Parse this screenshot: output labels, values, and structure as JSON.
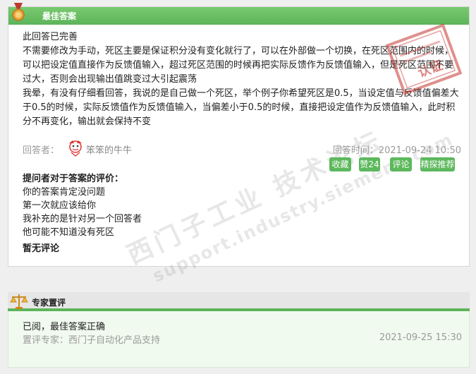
{
  "answer": {
    "header_title": "最佳答案",
    "body_lines": [
      "此回答已完善",
      "不需要修改为手动，死区主要是保证积分没有变化就行了，可以在外部做一个切换，在死区范围内的时候，可以把设定值直接作为反馈值输入，超过死区范围的时候再把实际反馈作为反馈值输入，但是死区范围不要过大，否则会出现输出值跳变过大引起震荡",
      "我晕，有没有仔细看回答，我说的是自己做一个死区，举个例子你希望死区是0.5，当设定值与反馈值偏差大于0.5的时候，实际反馈值作为反馈值输入，当偏差小于0.5的时候，直接把设定值作为反馈值输入，此时积分不再变化，输出就会保持不变"
    ],
    "answerer_label": "回答者：",
    "answerer_name": "笨笨的牛牛",
    "answer_time": "回答时间：2021-09-24 10:50",
    "stamp_text": "认证",
    "buttons": {
      "favorite": "收藏",
      "like": "赞24",
      "comment": "评论",
      "recommend": "精探推荐"
    },
    "evaluation_title": "提问者对于答案的评价：",
    "evaluation_lines": [
      "你的答案肯定没问题",
      "第一次就应该给你",
      "我补充的是针对另一个回答者",
      "他可能不知道没有死区"
    ],
    "no_comment": "暂无评论"
  },
  "watermark": {
    "line1": "西门子工业 技术论坛",
    "line2": "support.industry.siemens.com"
  },
  "expert": {
    "header_title": "专家置评",
    "verdict": "已阅，最佳答案正确",
    "reviewer": "置评专家：西门子自动化产品支持",
    "time": "2021-09-25 15:30"
  },
  "colors": {
    "accent_green": "#5cb45a",
    "button_green": "#5cb85c",
    "stamp_red": "#c4342d"
  }
}
